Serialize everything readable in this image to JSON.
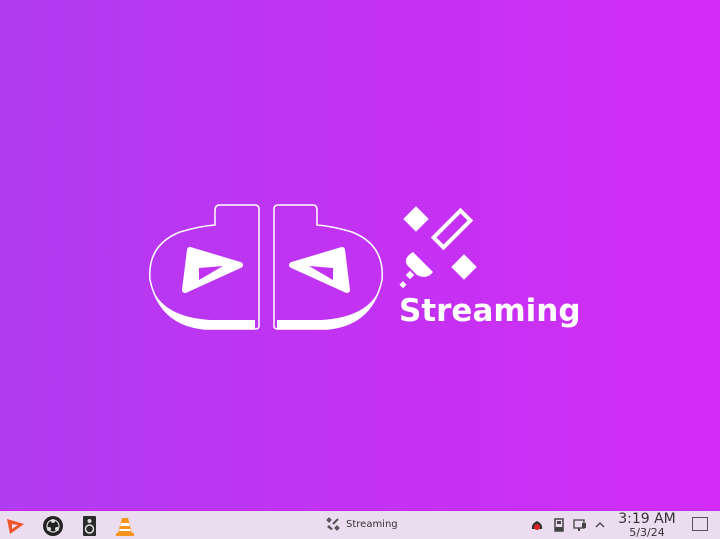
{
  "desktop": {
    "brand_text": "Streaming",
    "logo_name": "db"
  },
  "taskbar": {
    "launchers": [
      {
        "name": "app-menu",
        "icon": "play-triangle-icon"
      },
      {
        "name": "obs-studio",
        "icon": "obs-icon"
      },
      {
        "name": "audio-mixer",
        "icon": "speaker-icon"
      },
      {
        "name": "vlc",
        "icon": "vlc-cone-icon"
      }
    ],
    "task": {
      "label": "Streaming",
      "icon": "satellite-icon"
    },
    "clock": {
      "time": "3:19 AM",
      "date": "5/3/24"
    }
  },
  "colors": {
    "accent": "#c42ff2",
    "taskbar_bg": "#ecdcf0"
  }
}
